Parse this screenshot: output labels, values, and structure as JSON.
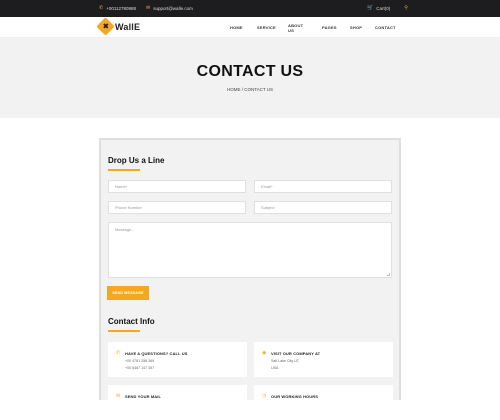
{
  "topbar": {
    "phone": "+00112780988",
    "email": "support@walle.com",
    "cart": "Cart(0)"
  },
  "header": {
    "logo_text": "WallE",
    "nav": [
      "HOME",
      "SERVICE",
      "ABOUT US",
      "PAGES",
      "SHOP",
      "CONTACT"
    ]
  },
  "hero": {
    "title": "CONTACT US",
    "breadcrumb": "HOME / CONTACT US"
  },
  "form": {
    "title": "Drop Us a Line",
    "name_placeholder": "Name*",
    "email_placeholder": "Email*",
    "phone_placeholder": "Phone Number",
    "subject_placeholder": "Subject",
    "message_placeholder": "Message...",
    "send_label": "SEND MESSAGE"
  },
  "contact_info": {
    "title": "Contact Info",
    "boxes": [
      {
        "title": "HAVE A QUESTIONS? CALL US",
        "lines": [
          "+00 4781 258 369",
          "+00 5487 147 357"
        ],
        "icon": "phone-icon"
      },
      {
        "title": "VISIT OUR COMPANY AT",
        "lines": [
          "Salt Lake City UT,",
          "USA"
        ],
        "icon": "location-pin-icon"
      },
      {
        "title": "SEND YOUR MAIL",
        "lines": [],
        "icon": "mail-icon"
      },
      {
        "title": "OUR WORKING HOURS",
        "lines": [],
        "icon": "clock-icon"
      }
    ]
  },
  "colors": {
    "accent": "#f5a623",
    "topbar_bg": "#1d1d1f",
    "hero_bg": "#f2f2f2"
  }
}
